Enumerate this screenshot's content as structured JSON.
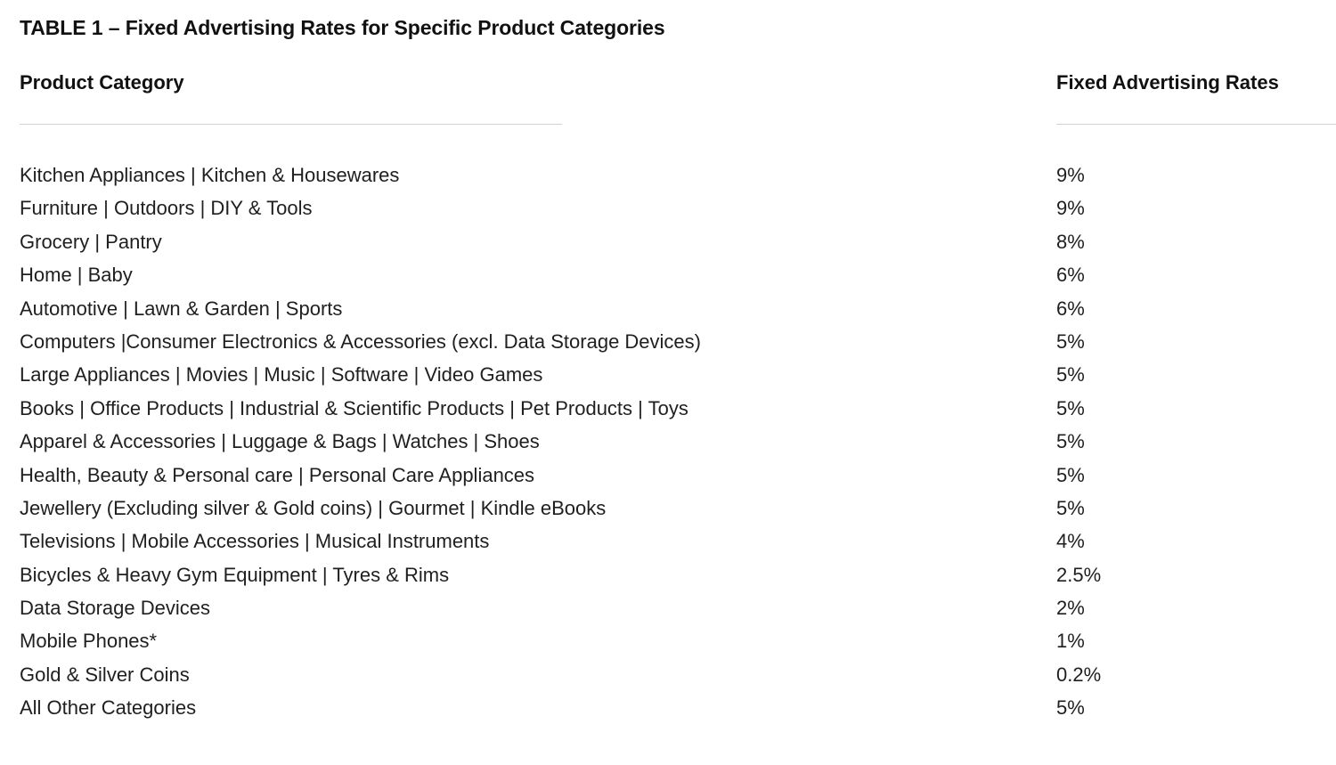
{
  "document": {
    "title": "TABLE 1 – Fixed Advertising Rates for Specific Product Categories",
    "background_color": "#ffffff",
    "text_color": "#1f1f1f",
    "rule_color": "#d2d2d2"
  },
  "table": {
    "headers": {
      "category": "Product Category",
      "rate": "Fixed Advertising Rates"
    },
    "rows": [
      {
        "category": "Kitchen Appliances | Kitchen & Housewares",
        "rate": "9%"
      },
      {
        "category": "Furniture | Outdoors | DIY & Tools",
        "rate": "9%"
      },
      {
        "category": "Grocery | Pantry",
        "rate": "8%"
      },
      {
        "category": "Home | Baby",
        "rate": "6%"
      },
      {
        "category": "Automotive | Lawn & Garden | Sports",
        "rate": "6%"
      },
      {
        "category": "Computers |Consumer Electronics & Accessories (excl. Data Storage Devices)",
        "rate": "5%"
      },
      {
        "category": "Large Appliances | Movies | Music | Software | Video Games",
        "rate": "5%"
      },
      {
        "category": "Books | Office Products | Industrial & Scientific Products | Pet Products | Toys",
        "rate": "5%"
      },
      {
        "category": "Apparel & Accessories | Luggage & Bags | Watches | Shoes",
        "rate": "5%"
      },
      {
        "category": "Health, Beauty & Personal care | Personal Care Appliances",
        "rate": "5%"
      },
      {
        "category": "Jewellery (Excluding silver & Gold coins) | Gourmet | Kindle eBooks",
        "rate": "5%"
      },
      {
        "category": "Televisions | Mobile Accessories | Musical Instruments",
        "rate": "4%"
      },
      {
        "category": "Bicycles & Heavy Gym Equipment | Tyres & Rims",
        "rate": "2.5%"
      },
      {
        "category": "Data Storage Devices",
        "rate": "2%"
      },
      {
        "category": "Mobile Phones*",
        "rate": "1%"
      },
      {
        "category": "Gold & Silver Coins",
        "rate": "0.2%"
      },
      {
        "category": "All Other Categories",
        "rate": "5%"
      }
    ]
  }
}
